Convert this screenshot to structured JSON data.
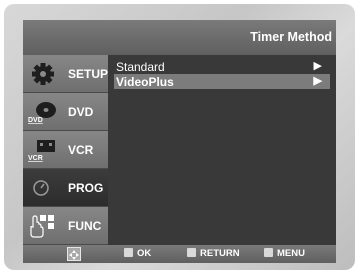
{
  "header": {
    "title": "Timer Method"
  },
  "sidebar": {
    "items": [
      {
        "label": "SETUP",
        "icon": "gear-icon",
        "active": false
      },
      {
        "label": "DVD",
        "icon": "dvd-disc-icon",
        "icon_text": "DVD",
        "active": false
      },
      {
        "label": "VCR",
        "icon": "vcr-cassette-icon",
        "icon_text": "VCR",
        "active": false
      },
      {
        "label": "PROG",
        "icon": "clock-icon",
        "active": true
      },
      {
        "label": "FUNC",
        "icon": "hand-grid-icon",
        "active": false
      }
    ]
  },
  "menu": {
    "options": [
      {
        "label": "Standard",
        "arrow": "▶",
        "selected": false
      },
      {
        "label": "VideoPlus",
        "arrow": "▶",
        "selected": true
      }
    ]
  },
  "footer": {
    "nav_icon": "dpad-icon",
    "hints": [
      {
        "icon": "ok-icon",
        "label": "OK"
      },
      {
        "icon": "return-icon",
        "label": "RETURN"
      },
      {
        "icon": "menu-icon",
        "label": "MENU"
      }
    ]
  },
  "colors": {
    "screen_bg": "#393939",
    "bar_gradient_top": "#7a7a7a",
    "selected_bg": "#7c7c7c",
    "text": "#ffffff"
  }
}
